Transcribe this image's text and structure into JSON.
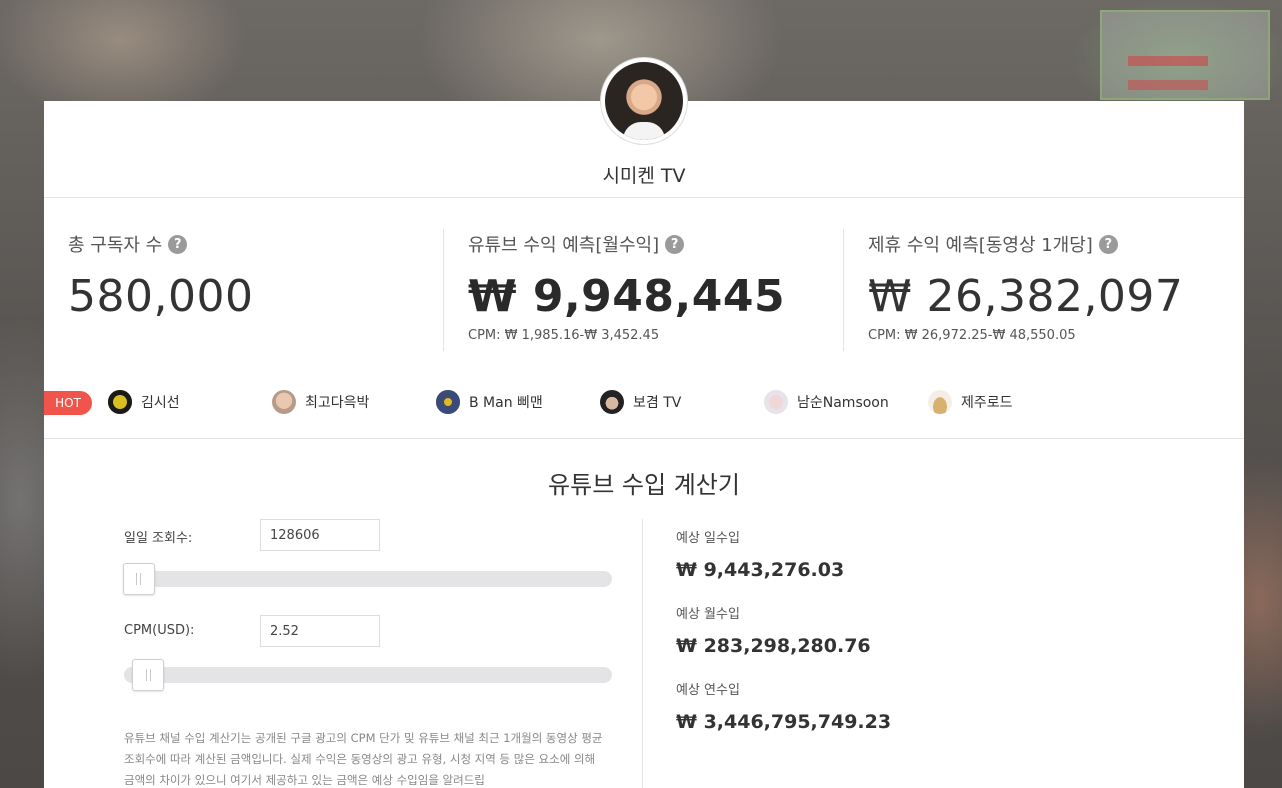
{
  "channel": {
    "name": "시미켄 TV"
  },
  "stats": [
    {
      "label": "총 구독자 수",
      "value": "580,000",
      "cpm": ""
    },
    {
      "label": "유튜브 수익 예측[월수익]",
      "value": "₩ 9,948,445",
      "cpm": "CPM: ₩ 1,985.16-₩ 3,452.45"
    },
    {
      "label": "제휴 수익 예측[동영상 1개당]",
      "value": "₩ 26,382,097",
      "cpm": "CPM: ₩ 26,972.25-₩ 48,550.05"
    }
  ],
  "hot": {
    "badge": "HOT",
    "items": [
      {
        "name": "김시선",
        "color": "#1a1a1a"
      },
      {
        "name": "최고다윽박",
        "color": "#c9a896"
      },
      {
        "name": "B Man 삐맨",
        "color": "#3a4a7a"
      },
      {
        "name": "보겸 TV",
        "color": "#2a2a2a"
      },
      {
        "name": "남순Namsoon",
        "color": "#e8dce0"
      },
      {
        "name": "제주로드",
        "color": "#d8b070"
      }
    ]
  },
  "calculator": {
    "title": "유튜브 수입 계산기",
    "daily_views_label": "일일 조회수:",
    "daily_views_value": "128606",
    "daily_views_level": 0.03,
    "cpm_label": "CPM(USD):",
    "cpm_value": "2.52",
    "cpm_level": 0.05,
    "results": [
      {
        "label": "예상 일수입",
        "value": "₩ 9,443,276.03"
      },
      {
        "label": "예상 월수입",
        "value": "₩ 283,298,280.76"
      },
      {
        "label": "예상 연수입",
        "value": "₩ 3,446,795,749.23"
      }
    ],
    "description": "유튜브 채널 수입 계산기는 공개된 구글 광고의 CPM 단가 및 유튜브 채널 최근 1개월의 동영상 평균 조회수에 따라 계산된 금액입니다. 실제 수익은 동영상의 광고 유형, 시청 지역 등 많은 요소에 의해 금액의 차이가 있으니 여기서 제공하고 있는 금액은 예상 수입임을 알려드립"
  }
}
